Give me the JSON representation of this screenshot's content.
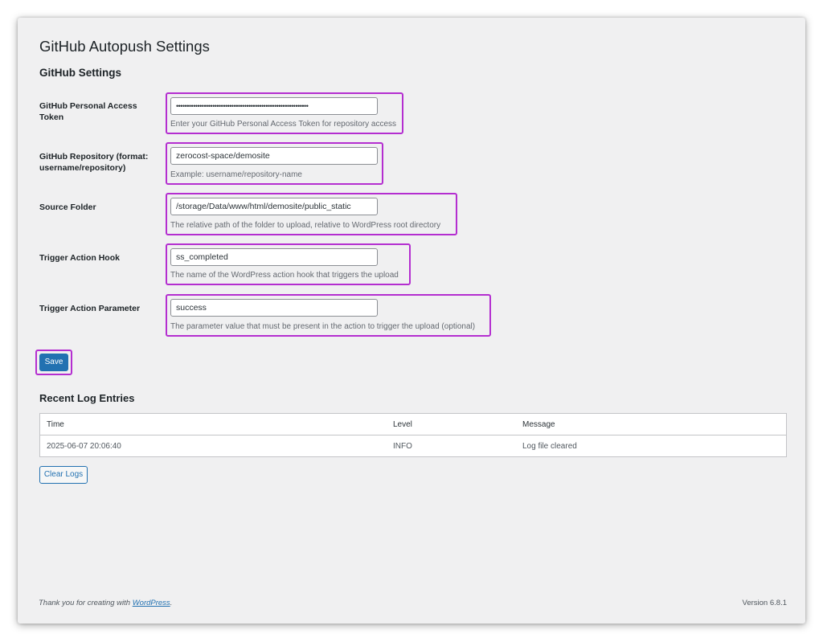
{
  "page": {
    "title": "GitHub Autopush Settings",
    "section_title": "GitHub Settings"
  },
  "fields": {
    "token": {
      "label": "GitHub Personal Access Token",
      "value": "••••••••••••••••••••••••••••••••••••••••••••••••••••••••••••••",
      "description": "Enter your GitHub Personal Access Token for repository access"
    },
    "repository": {
      "label_line1": "GitHub Repository (format:",
      "label_line2": "username/repository)",
      "value": "zerocost-space/demosite",
      "description": "Example: username/repository-name"
    },
    "source_folder": {
      "label": "Source Folder",
      "value": "/storage/Data/www/html/demosite/public_static",
      "description": "The relative path of the folder to upload, relative to WordPress root directory"
    },
    "trigger_hook": {
      "label": "Trigger Action Hook",
      "value": "ss_completed",
      "description": "The name of the WordPress action hook that triggers the upload"
    },
    "trigger_param": {
      "label": "Trigger Action Parameter",
      "value": "success",
      "description": "The parameter value that must be present in the action to trigger the upload (optional)"
    }
  },
  "save_label": "Save",
  "logs": {
    "title": "Recent Log Entries",
    "columns": [
      "Time",
      "Level",
      "Message"
    ],
    "rows": [
      {
        "time": "2025-06-07 20:06:40",
        "level": "INFO",
        "message": "Log file cleared"
      }
    ],
    "clear_label": "Clear Logs"
  },
  "footer": {
    "thanks_prefix": "Thank you for creating with ",
    "link_text": "WordPress",
    "thanks_suffix": ".",
    "version": "Version 6.8.1"
  },
  "colors": {
    "highlight": "#b42ed0",
    "primary": "#2271b1"
  }
}
